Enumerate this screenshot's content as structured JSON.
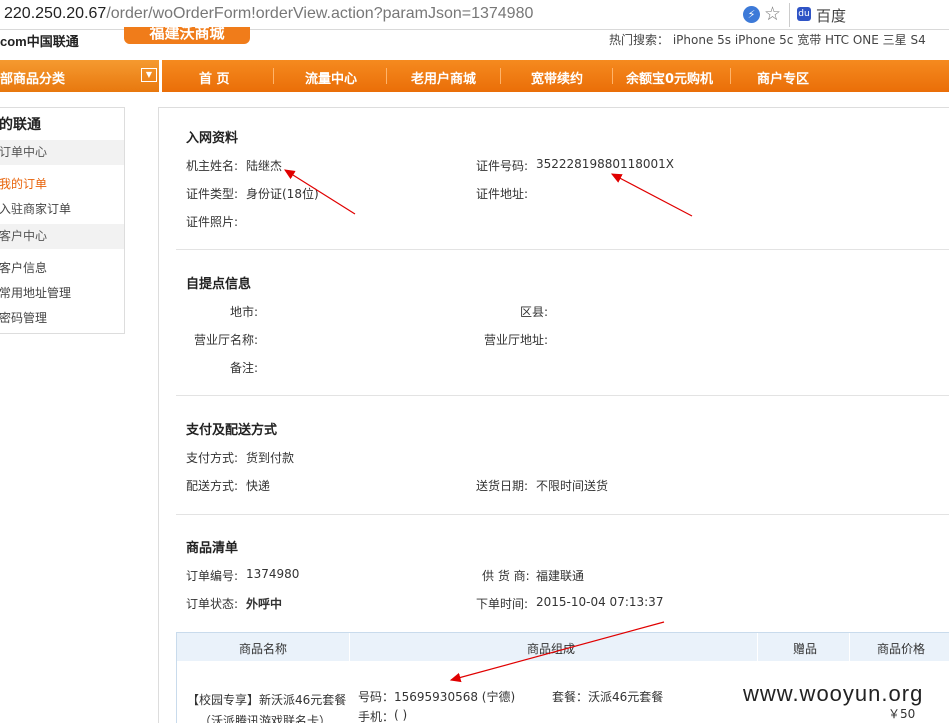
{
  "browser": {
    "url_host": "220.250.20.67",
    "url_path": "/order/woOrderForm!orderView.action?paramJson=1374980",
    "search_engine": "百度"
  },
  "header": {
    "logo_text": "com中国联通",
    "mall_logo": "福建沃商城",
    "hot_search": "热门搜索：  iPhone 5s  iPhone 5c  宽带  HTC ONE  三星 S4"
  },
  "nav": {
    "category_label": "部商品分类",
    "items": [
      "首  页",
      "流量中心",
      "老用户商城",
      "宽带续约",
      "余额宝0元购机",
      "商户专区"
    ]
  },
  "sidebar": {
    "title": "的联通",
    "sections": [
      "订单中心",
      "客户中心"
    ],
    "order_items": [
      "我的订单",
      "入驻商家订单"
    ],
    "customer_items": [
      "客户信息",
      "常用地址管理",
      "密码管理"
    ]
  },
  "network_info": {
    "title": "入网资料",
    "owner_name_label": "机主姓名:",
    "owner_name": "陆继杰",
    "id_number_label": "证件号码:",
    "id_number": "35222819880118001X",
    "id_type_label": "证件类型:",
    "id_type": "身份证(18位)",
    "id_address_label": "证件地址:",
    "id_address": "",
    "id_photo_label": "证件照片:"
  },
  "pickup_info": {
    "title": "自提点信息",
    "city_label": "地市:",
    "district_label": "区县:",
    "hall_name_label": "营业厅名称:",
    "hall_address_label": "营业厅地址:",
    "note_label": "备注:"
  },
  "payment_info": {
    "title": "支付及配送方式",
    "pay_method_label": "支付方式:",
    "pay_method": "货到付款",
    "ship_method_label": "配送方式:",
    "ship_method": "快递",
    "ship_date_label": "送货日期:",
    "ship_date": "不限时间送货"
  },
  "goods_list": {
    "title": "商品清单",
    "order_no_label": "订单编号:",
    "order_no": "1374980",
    "supplier_label": "供 货 商:",
    "supplier": "福建联通",
    "status_label": "订单状态:",
    "status": "外呼中",
    "order_time_label": "下单时间:",
    "order_time": "2015-10-04 07:13:37"
  },
  "product_table": {
    "headers": [
      "商品名称",
      "商品组成",
      "赠品",
      "商品价格"
    ],
    "row": {
      "name_line1": "【校园专享】新沃派46元套餐",
      "name_line2": "（沃派腾讯游戏联名卡）",
      "number_label": "号码：",
      "number": "15695930568 (宁德)",
      "package_label": "套餐：",
      "package": "沃派46元套餐",
      "phone_label": "手机：",
      "phone": "( )",
      "price": "￥50"
    }
  },
  "watermark": "www.wooyun.org",
  "colors": {
    "nav_orange": "#ef7a14",
    "arrow_red": "#e00000",
    "table_header": "#eaf2fa"
  }
}
